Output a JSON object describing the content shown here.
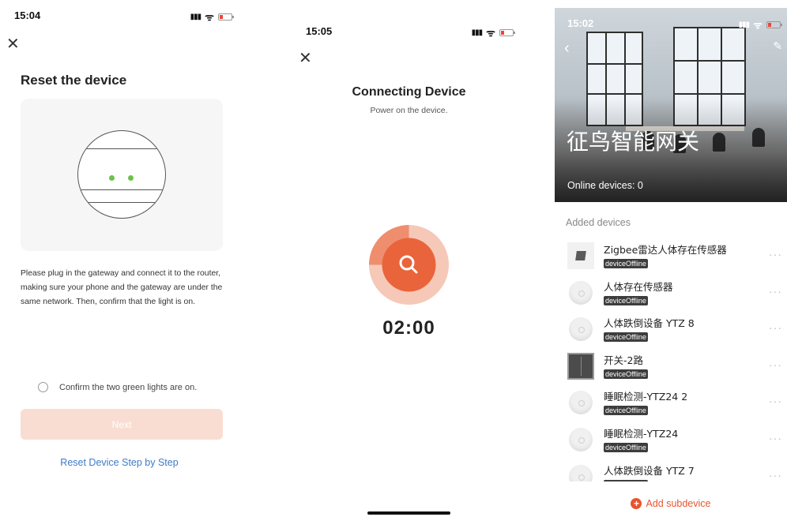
{
  "reset_screen": {
    "status_time": "15:04",
    "title": "Reset the device",
    "description": "Please plug in the gateway and connect it to the router, making sure your phone and the gateway are under the same network. Then, confirm that the light is on.",
    "confirm_label": "Confirm the two green lights are on.",
    "next_label": "Next",
    "step_link": "Reset Device Step by Step"
  },
  "connecting_screen": {
    "status_time": "15:05",
    "title": "Connecting Device",
    "subtitle": "Power on the device.",
    "countdown": "02:00",
    "progress": 0.25
  },
  "gateway_screen": {
    "status_time": "15:02",
    "gateway_name": "征鸟智能网关",
    "online_devices": "Online devices: 0",
    "section_label": "Added devices",
    "add_subdevice": "Add subdevice",
    "devices": [
      {
        "name": "Zigbee雷达人体存在传感器",
        "status": "deviceOffline",
        "icon": "sensor-square-icon"
      },
      {
        "name": "人体存在传感器",
        "status": "deviceOffline",
        "icon": "round-sensor-icon"
      },
      {
        "name": "人体跌倒设备 YTZ  8",
        "status": "deviceOffline",
        "icon": "round-sensor-icon"
      },
      {
        "name": "开关-2路",
        "status": "deviceOffline",
        "icon": "switch-icon"
      },
      {
        "name": "睡眠检测-YTZ24 2",
        "status": "deviceOffline",
        "icon": "round-sensor-icon"
      },
      {
        "name": "睡眠检测-YTZ24",
        "status": "deviceOffline",
        "icon": "round-sensor-icon"
      },
      {
        "name": "人体跌倒设备 YTZ  7",
        "status": "deviceOffline",
        "icon": "round-sensor-icon"
      }
    ]
  },
  "icons": {
    "close": "close-icon",
    "back": "back-arrow-icon",
    "edit": "edit-pencil-icon",
    "search": "search-icon",
    "more": "more-dots-icon",
    "add": "plus-circle-icon"
  },
  "colors": {
    "accent": "#e8552d",
    "next_disabled": "#f9ddd3",
    "link": "#3d7bc8",
    "led_green": "#6cc24a"
  }
}
